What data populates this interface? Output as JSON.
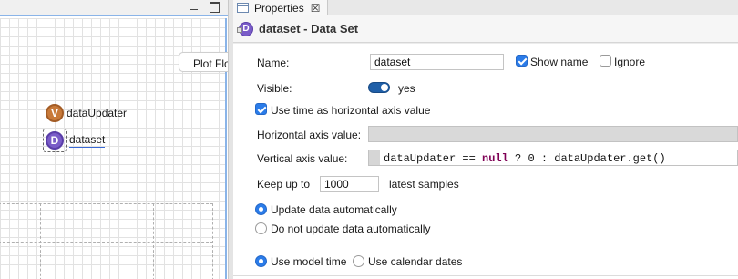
{
  "canvas": {
    "plot_button_label": "Plot Flo",
    "items": [
      {
        "icon_letter": "V",
        "label": "dataUpdater"
      },
      {
        "icon_letter": "D",
        "label": "dataset"
      }
    ]
  },
  "properties": {
    "tab_label": "Properties",
    "tab_close": "☒",
    "header_icon_letter": "D",
    "header_title": "dataset - Data Set",
    "name_label": "Name:",
    "name_value": "dataset",
    "show_name_label": "Show name",
    "show_name_checked": true,
    "ignore_label": "Ignore",
    "ignore_checked": false,
    "visible_label": "Visible:",
    "visible_value": "yes",
    "use_time_label": "Use time as horizontal axis value",
    "use_time_checked": true,
    "horizontal_label": "Horizontal axis value:",
    "horizontal_value": "",
    "vertical_label": "Vertical axis value:",
    "vertical_code": {
      "part1": "dataUpdater == ",
      "kw": "null",
      "part2": " ? 0 : dataUpdater.get()"
    },
    "keep_up_to_label": "Keep up to",
    "keep_up_to_value": "1000",
    "latest_samples_label": "latest samples",
    "update_options": [
      {
        "label": "Update data automatically",
        "selected": true
      },
      {
        "label": "Do not update data automatically",
        "selected": false
      }
    ],
    "time_options": [
      {
        "label": "Use model time",
        "selected": true
      },
      {
        "label": "Use calendar dates",
        "selected": false
      }
    ]
  }
}
